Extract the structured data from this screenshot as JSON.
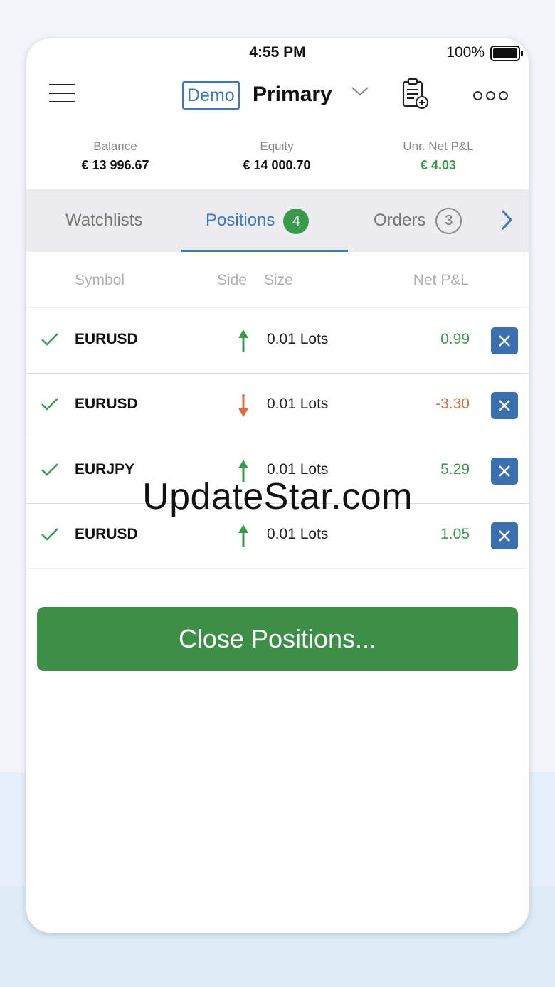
{
  "status_bar": {
    "time": "4:55 PM",
    "battery": "100%"
  },
  "header": {
    "account_type": "Demo",
    "account_name": "Primary"
  },
  "summary": {
    "balance_label": "Balance",
    "balance_value": "€ 13 996.67",
    "equity_label": "Equity",
    "equity_value": "€ 14 000.70",
    "pnl_label": "Unr. Net P&L",
    "pnl_value": "€ 4.03"
  },
  "tabs": [
    {
      "label": "Watchlists"
    },
    {
      "label": "Positions",
      "count": "4"
    },
    {
      "label": "Orders",
      "count": "3"
    }
  ],
  "columns": {
    "symbol": "Symbol",
    "side": "Side",
    "size": "Size",
    "pnl": "Net P&L"
  },
  "positions": [
    {
      "symbol": "EURUSD",
      "side": "buy",
      "size": "0.01 Lots",
      "pnl": "0.99"
    },
    {
      "symbol": "EURUSD",
      "side": "sell",
      "size": "0.01 Lots",
      "pnl": "-3.30"
    },
    {
      "symbol": "EURJPY",
      "side": "buy",
      "size": "0.01 Lots",
      "pnl": "5.29"
    },
    {
      "symbol": "EURUSD",
      "side": "buy",
      "size": "0.01 Lots",
      "pnl": "1.05"
    }
  ],
  "actions": {
    "close_positions": "Close Positions..."
  },
  "watermark": "UpdateStar.com",
  "colors": {
    "accent_blue": "#3a78c4",
    "green": "#3a9a4c",
    "red": "#e06b3a",
    "button_green": "#3d8f47",
    "close_blue": "#3a6fb0"
  }
}
